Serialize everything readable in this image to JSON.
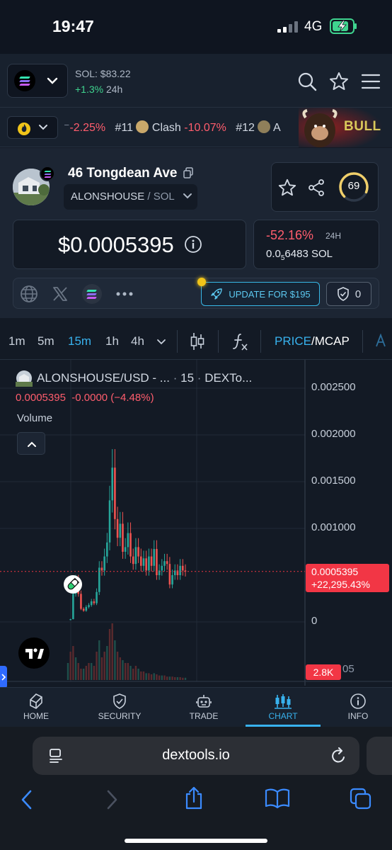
{
  "status_bar": {
    "time": "19:47",
    "network": "4G"
  },
  "header": {
    "sol_price": "SOL: $83.22",
    "sol_change": "+1.3%",
    "sol_change_period": "24h",
    "icons": [
      "search-icon",
      "star-icon",
      "menu-icon"
    ]
  },
  "ticker": {
    "items": [
      {
        "text": "-2.25%",
        "neg": true
      },
      {
        "rank": "#11",
        "name": "Clash",
        "change": "-10.07%"
      },
      {
        "rank": "#12",
        "name": "A"
      }
    ],
    "brand": "BULL"
  },
  "token": {
    "name": "46 Tongdean Ave",
    "pair_base": "ALONSHOUSE",
    "pair_sep": " / ",
    "pair_quote": "SOL",
    "score": "69",
    "price": "$0.0005395",
    "change": "-52.16%",
    "change_period": "24H",
    "sol_amount_prefix": "0.0",
    "sol_amount_sub": "5",
    "sol_amount_suffix": "6483 SOL",
    "update_label": "UPDATE FOR $195",
    "shield_count": "0"
  },
  "timeframes": [
    "1m",
    "5m",
    "15m",
    "1h",
    "4h"
  ],
  "active_timeframe": "15m",
  "chart_toolbar": {
    "price": "PRICE",
    "sep": "/",
    "mcap": "MCAP"
  },
  "chart": {
    "symbol": "ALONSHOUSE/USD - ...",
    "interval": "15",
    "source": "DEXTo...",
    "ohlc_price": "0.0005395",
    "ohlc_change": "-0.0000 (−4.48%)",
    "volume_label": "Volume",
    "price_tag": "0.0005395",
    "price_tag_pct": "+22,295.43%",
    "volume_tag": "2.8K",
    "volume_tick_partial": "05"
  },
  "chart_data": {
    "type": "line",
    "title": "ALONSHOUSE/USD",
    "y_ticks": [
      "0.002500",
      "0.002000",
      "0.001500",
      "0.001000",
      "0"
    ],
    "ylim": [
      0,
      0.0025
    ],
    "last_price": 0.0005395,
    "series": [
      {
        "values": [
          2e-05,
          3e-05,
          0.0003,
          0.00045,
          0.0003,
          0.00014,
          0.00012,
          0.00016,
          0.00018,
          0.00022,
          0.0002,
          0.00032,
          0.00058,
          0.00055,
          0.0007,
          0.00085,
          0.0013,
          0.00165,
          0.0011,
          0.0009,
          0.00105,
          0.00075,
          0.0008,
          0.00095,
          0.0007,
          0.00062,
          0.0008,
          0.0007,
          0.0006,
          0.00068,
          0.00055,
          0.0007,
          0.0006,
          0.00078,
          0.0005,
          0.00055,
          0.0006,
          0.00065,
          0.00062,
          0.0004,
          0.0005,
          0.00055,
          0.0005,
          0.0006,
          0.00055,
          0.0005395
        ]
      }
    ],
    "volume": [
      0.3,
      0.5,
      0.6,
      0.4,
      0.3,
      0.2,
      0.2,
      0.25,
      0.3,
      0.3,
      0.25,
      0.5,
      0.7,
      0.4,
      0.5,
      0.6,
      0.9,
      1.0,
      0.7,
      0.5,
      0.4,
      0.35,
      0.3,
      0.3,
      0.25,
      0.2,
      0.25,
      0.2,
      0.15,
      0.15,
      0.12,
      0.12,
      0.1,
      0.12,
      0.1,
      0.08,
      0.08,
      0.08,
      0.06,
      0.06,
      0.06,
      0.05,
      0.05,
      0.05,
      0.04,
      0.04
    ]
  },
  "bottom_nav": [
    {
      "label": "HOME",
      "icon": "dextools-logo-icon"
    },
    {
      "label": "SECURITY",
      "icon": "shield-check-icon"
    },
    {
      "label": "TRADE",
      "icon": "robot-icon"
    },
    {
      "label": "CHART",
      "icon": "candles-icon",
      "active": true
    },
    {
      "label": "INFO",
      "icon": "info-icon"
    }
  ],
  "browser": {
    "url": "dextools.io"
  },
  "colors": {
    "accent": "#38b2ee",
    "negative": "#ff5d6d",
    "positive": "#3fd48f",
    "bg": "#131a25"
  }
}
